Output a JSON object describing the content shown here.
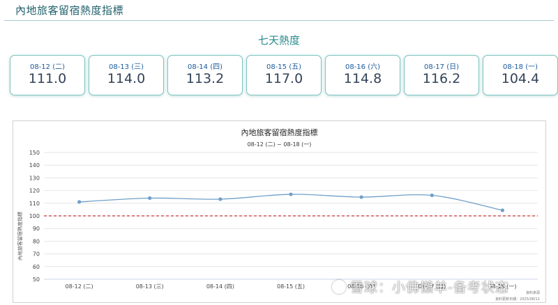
{
  "page": {
    "title": "內地旅客留宿熱度指標"
  },
  "section": {
    "title": "七天熱度"
  },
  "cards": [
    {
      "date": "08-12 (二)",
      "value": "111.0"
    },
    {
      "date": "08-13 (三)",
      "value": "114.0"
    },
    {
      "date": "08-14 (四)",
      "value": "113.2"
    },
    {
      "date": "08-15 (五)",
      "value": "117.0"
    },
    {
      "date": "08-16 (六)",
      "value": "114.8"
    },
    {
      "date": "08-17 (日)",
      "value": "116.2"
    },
    {
      "date": "08-18 (一)",
      "value": "104.4"
    }
  ],
  "chart_data": {
    "type": "line",
    "title": "內地旅客留宿熱度指標",
    "subtitle": "08-12 (二) ~ 08-18 (一)",
    "ylabel": "內地旅客留宿熱度指標",
    "categories": [
      "08-12 (二)",
      "08-13 (三)",
      "08-14 (四)",
      "08-15 (五)",
      "08-16 (六)",
      "08-17 (日)",
      "08-18 (一)"
    ],
    "series": [
      {
        "values": [
          111.0,
          114.0,
          113.2,
          117.0,
          114.8,
          116.2,
          104.4
        ]
      }
    ],
    "reference_line": {
      "value": 100,
      "style": "dashed",
      "color": "#cc3333"
    },
    "ylim": [
      50,
      150
    ],
    "yticks": [
      50,
      60,
      70,
      80,
      90,
      100,
      110,
      120,
      130,
      140,
      150
    ],
    "grid": true,
    "line_color": "#6f9fc8",
    "credits": [
      "資料來源",
      "資料更新日期：2025/08/11"
    ]
  },
  "watermark": {
    "text": "雪球：小佛懶羊-备考状态"
  }
}
